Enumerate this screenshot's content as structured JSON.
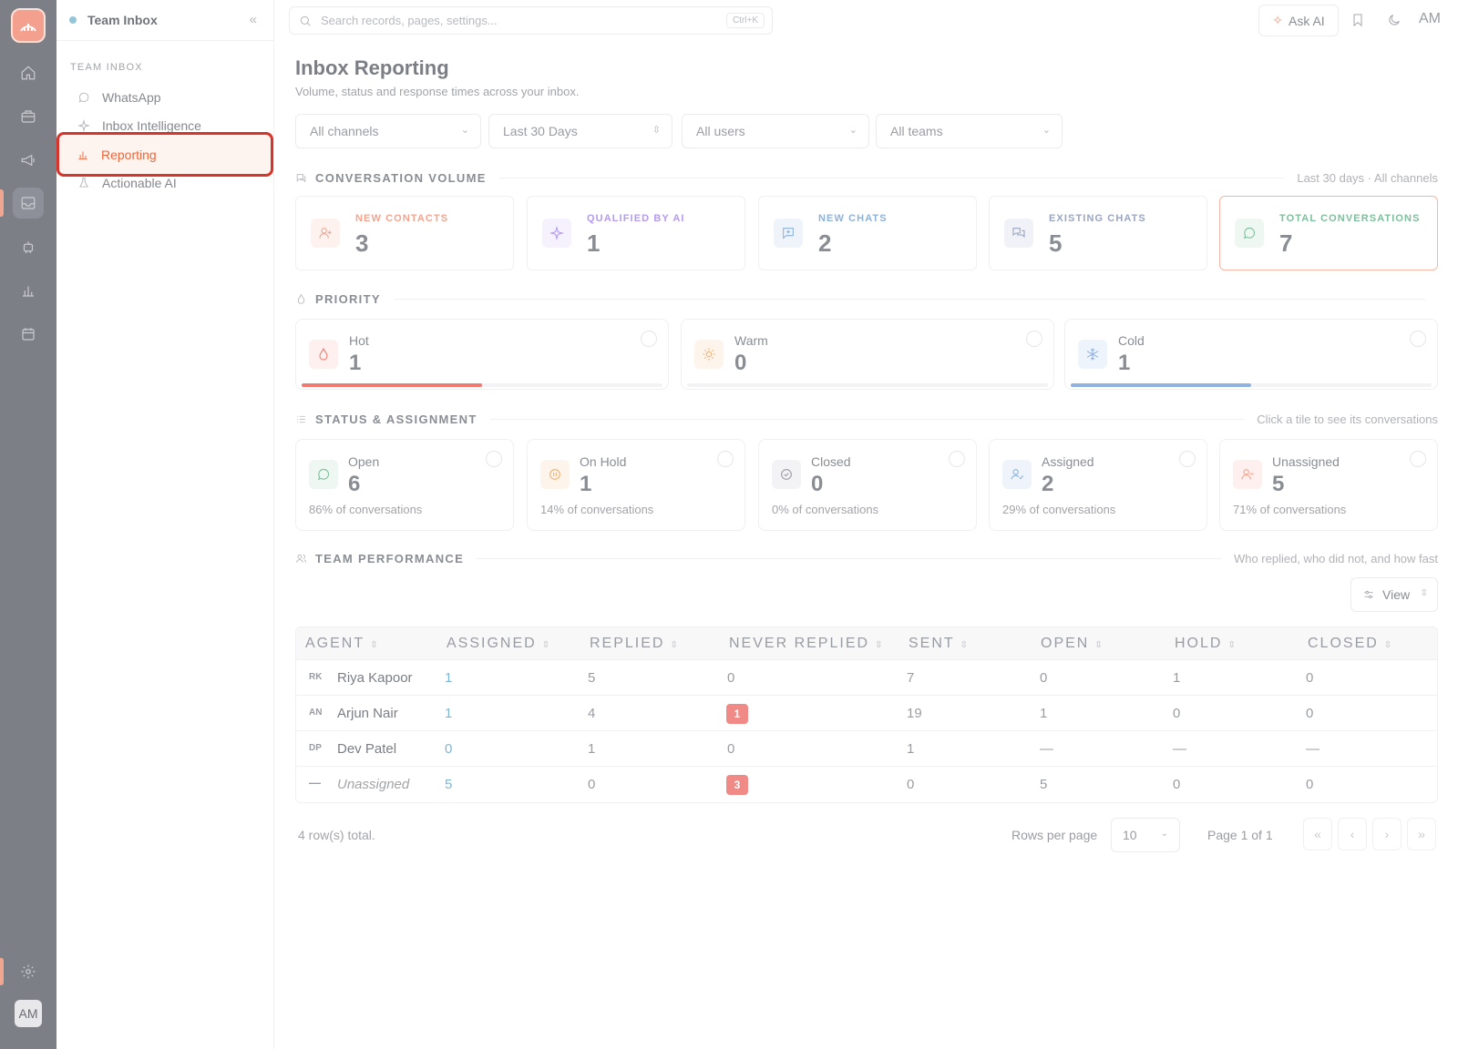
{
  "app": {
    "workspace": "Team Inbox"
  },
  "rail": {
    "icons": [
      "home-icon",
      "briefcase-icon",
      "megaphone-icon",
      "inbox-icon",
      "robot-icon",
      "chart-icon",
      "calendar-icon",
      "settings-icon"
    ],
    "avatar": "AM"
  },
  "sidebar": {
    "group_label": "TEAM INBOX",
    "items": [
      {
        "label": "WhatsApp",
        "icon": "whatsapp-icon"
      },
      {
        "label": "Inbox Intelligence",
        "icon": "sparkles-icon"
      },
      {
        "label": "Reporting",
        "icon": "bar-chart-icon",
        "active": true
      },
      {
        "label": "Actionable AI",
        "icon": "flask-icon"
      }
    ]
  },
  "topbar": {
    "search_placeholder": "Search records, pages, settings...",
    "search_shortcut": "Ctrl+K",
    "ask_ai": "Ask AI",
    "avatar": "AM"
  },
  "header": {
    "title": "Inbox Reporting",
    "subtitle": "Volume, status and response times across your inbox."
  },
  "filters": {
    "channels": "All channels",
    "range": "Last 30 Days",
    "users": "All users",
    "teams": "All teams"
  },
  "volume": {
    "title": "CONVERSATION VOLUME",
    "note": "Last 30 days · All channels",
    "cards": [
      {
        "label": "NEW CONTACTS",
        "value": "3",
        "color": "#f4a48e"
      },
      {
        "label": "QUALIFIED BY AI",
        "value": "1",
        "color": "#b59af0"
      },
      {
        "label": "NEW CHATS",
        "value": "2",
        "color": "#8fb2d8"
      },
      {
        "label": "EXISTING CHATS",
        "value": "5",
        "color": "#9aa5c2"
      },
      {
        "label": "TOTAL CONVERSATIONS",
        "value": "7",
        "color": "#7dbf9c"
      }
    ]
  },
  "priority": {
    "title": "PRIORITY",
    "cards": [
      {
        "label": "Hot",
        "value": "1",
        "fill": 0.5,
        "color": "#ef7a72"
      },
      {
        "label": "Warm",
        "value": "0",
        "fill": 0,
        "color": "#f0b070"
      },
      {
        "label": "Cold",
        "value": "1",
        "fill": 0.5,
        "color": "#8fb2e0"
      }
    ]
  },
  "status": {
    "title": "STATUS & ASSIGNMENT",
    "note": "Click a tile to see its conversations",
    "cards": [
      {
        "label": "Open",
        "value": "6",
        "pct": "86% of conversations"
      },
      {
        "label": "On Hold",
        "value": "1",
        "pct": "14% of conversations"
      },
      {
        "label": "Closed",
        "value": "0",
        "pct": "0% of conversations"
      },
      {
        "label": "Assigned",
        "value": "2",
        "pct": "29% of conversations"
      },
      {
        "label": "Unassigned",
        "value": "5",
        "pct": "71% of conversations"
      }
    ]
  },
  "team": {
    "title": "TEAM PERFORMANCE",
    "note": "Who replied, who did not, and how fast",
    "view_button": "View",
    "columns": [
      "AGENT",
      "ASSIGNED",
      "REPLIED",
      "NEVER REPLIED",
      "SENT",
      "OPEN",
      "HOLD",
      "CLOSED"
    ],
    "rows": [
      {
        "initials": "RK",
        "agent": "Riya Kapoor",
        "assigned": "1",
        "replied": "5",
        "never": "0",
        "sent": "7",
        "open": "0",
        "hold": "1",
        "closed": "0"
      },
      {
        "initials": "AN",
        "agent": "Arjun Nair",
        "assigned": "1",
        "replied": "4",
        "never": "1",
        "sent": "19",
        "open": "1",
        "hold": "0",
        "closed": "0"
      },
      {
        "initials": "DP",
        "agent": "Dev Patel",
        "assigned": "0",
        "replied": "1",
        "never": "0",
        "sent": "1",
        "open": "—",
        "hold": "—",
        "closed": "—"
      },
      {
        "initials": "—",
        "agent": "Unassigned",
        "assigned": "5",
        "replied": "0",
        "never": "3",
        "sent": "0",
        "open": "5",
        "hold": "0",
        "closed": "0"
      }
    ],
    "rows_total": "4 row(s) total.",
    "rows_per_page_label": "Rows per page",
    "rows_per_page": "10",
    "page_of": "Page 1 of 1",
    "pager": [
      "«",
      "‹",
      "›",
      "»"
    ]
  }
}
